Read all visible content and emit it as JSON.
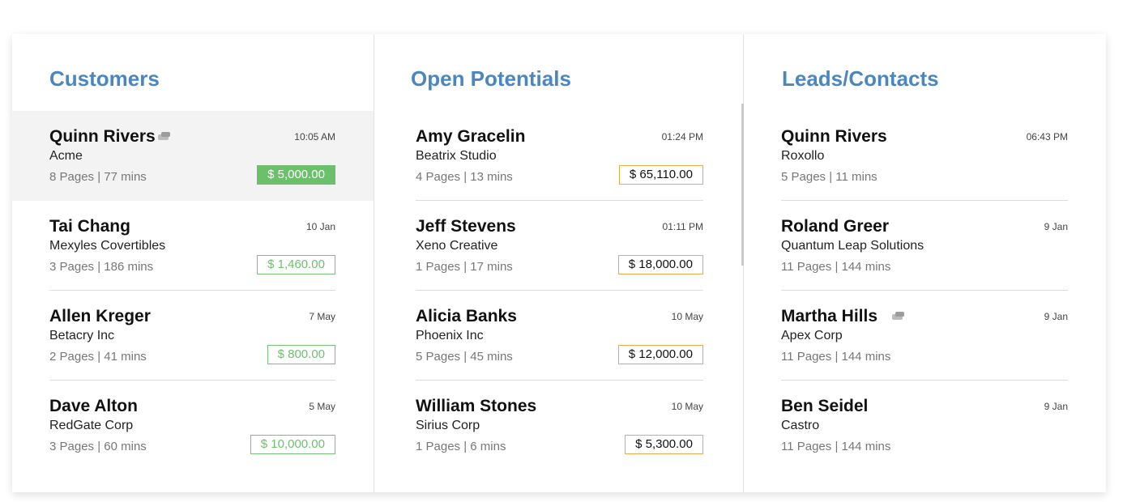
{
  "columns": [
    {
      "title": "Customers",
      "items": [
        {
          "name": "Quinn Rivers",
          "company": "Acme",
          "meta": "8 Pages | 77 mins",
          "time": "10:05 AM",
          "amount": "$ 5,000.00"
        },
        {
          "name": "Tai Chang",
          "company": "Mexyles Covertibles",
          "meta": "3 Pages | 186 mins",
          "time": "10 Jan",
          "amount": "$ 1,460.00"
        },
        {
          "name": "Allen Kreger",
          "company": "Betacry Inc",
          "meta": "2 Pages | 41 mins",
          "time": "7 May",
          "amount": "$ 800.00"
        },
        {
          "name": "Dave Alton",
          "company": "RedGate Corp",
          "meta": "3 Pages | 60 mins",
          "time": "5 May",
          "amount": "$ 10,000.00"
        }
      ]
    },
    {
      "title": "Open Potentials",
      "items": [
        {
          "name": "Amy Gracelin",
          "company": "Beatrix Studio",
          "meta": "4 Pages | 13 mins",
          "time": "01:24 PM",
          "amount": "$ 65,110.00"
        },
        {
          "name": "Jeff Stevens",
          "company": "Xeno Creative",
          "meta": "1 Pages | 17 mins",
          "time": "01:11 PM",
          "amount": "$ 18,000.00"
        },
        {
          "name": "Alicia Banks",
          "company": "Phoenix Inc",
          "meta": "5 Pages | 45 mins",
          "time": "10 May",
          "amount": "$ 12,000.00"
        },
        {
          "name": "William Stones",
          "company": "Sirius Corp",
          "meta": "1 Pages | 6 mins",
          "time": "10 May",
          "amount": "$ 5,300.00"
        }
      ]
    },
    {
      "title": "Leads/Contacts",
      "items": [
        {
          "name": "Quinn Rivers",
          "company": "Roxollo",
          "meta": "5 Pages | 11 mins",
          "time": "06:43 PM"
        },
        {
          "name": "Roland Greer",
          "company": "Quantum Leap Solutions",
          "meta": "11 Pages | 144 mins",
          "time": "9 Jan"
        },
        {
          "name": "Martha Hills",
          "company": "Apex Corp",
          "meta": "11 Pages | 144 mins",
          "time": "9 Jan"
        },
        {
          "name": "Ben Seidel",
          "company": "Castro",
          "meta": "11 Pages | 144 mins",
          "time": "9 Jan"
        }
      ]
    }
  ],
  "icons": {
    "chat": "chat-bubbles-icon"
  },
  "colors": {
    "title": "#4a86c0",
    "green": "#6cc06c",
    "orange": "#f0a848"
  }
}
